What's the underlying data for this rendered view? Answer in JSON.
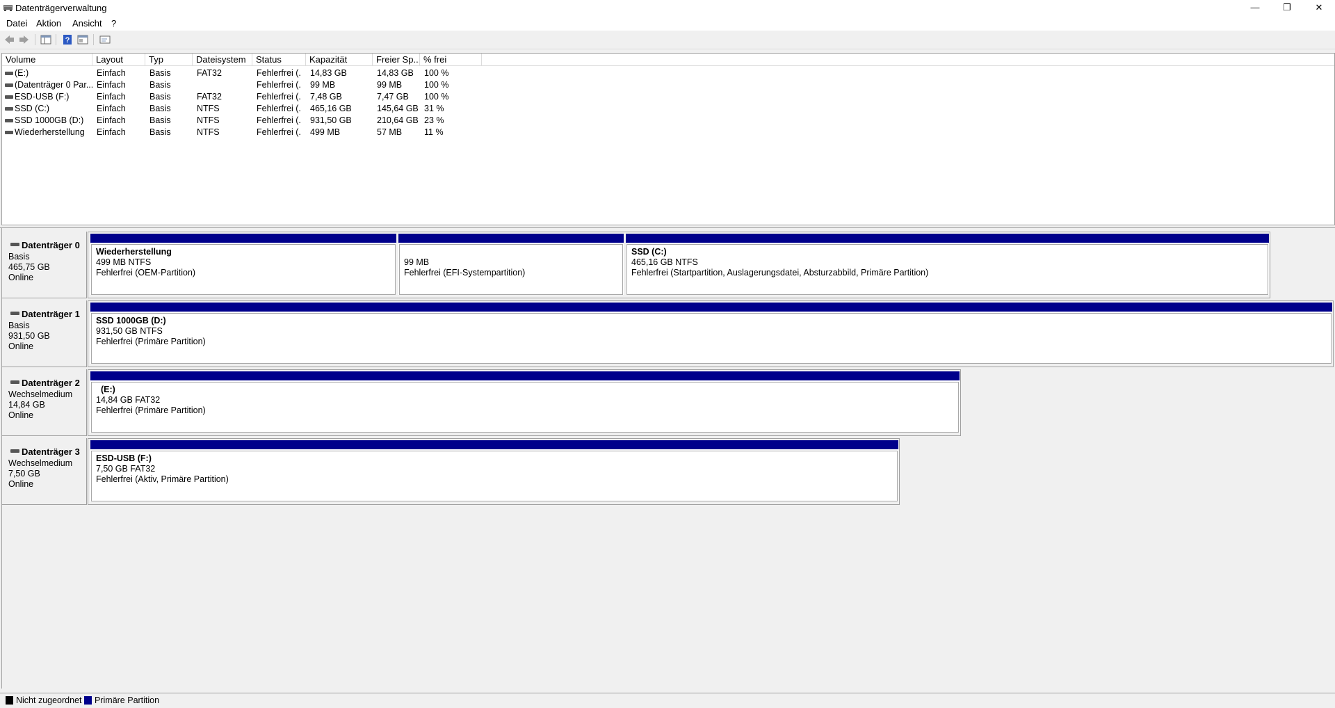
{
  "window": {
    "title": "Datenträgerverwaltung",
    "min": "—",
    "max": "❐",
    "close": "✕"
  },
  "menu": [
    "Datei",
    "Aktion",
    "Ansicht",
    "?"
  ],
  "toolbar": [
    "back-icon",
    "forward-icon",
    "disk-list-icon",
    "help-icon",
    "properties-icon",
    "console-icon"
  ],
  "columns": [
    "Volume",
    "Layout",
    "Typ",
    "Dateisystem",
    "Status",
    "Kapazität",
    "Freier Sp...",
    "% frei"
  ],
  "volumes": [
    [
      "(E:)",
      "Einfach",
      "Basis",
      "FAT32",
      "Fehlerfrei (...",
      "14,83 GB",
      "14,83 GB",
      "100 %"
    ],
    [
      "(Datenträger 0 Par...",
      "Einfach",
      "Basis",
      "",
      "Fehlerfrei (...",
      "99 MB",
      "99 MB",
      "100 %"
    ],
    [
      "ESD-USB (F:)",
      "Einfach",
      "Basis",
      "FAT32",
      "Fehlerfrei (...",
      "7,48 GB",
      "7,47 GB",
      "100 %"
    ],
    [
      "SSD (C:)",
      "Einfach",
      "Basis",
      "NTFS",
      "Fehlerfrei (...",
      "465,16 GB",
      "145,64 GB",
      "31 %"
    ],
    [
      "SSD 1000GB (D:)",
      "Einfach",
      "Basis",
      "NTFS",
      "Fehlerfrei (...",
      "931,50 GB",
      "210,64 GB",
      "23 %"
    ],
    [
      "Wiederherstellung",
      "Einfach",
      "Basis",
      "NTFS",
      "Fehlerfrei (...",
      "499 MB",
      "57 MB",
      "11 %"
    ]
  ],
  "disks": [
    {
      "name": "Datenträger 0",
      "type": "Basis",
      "size": "465,75 GB",
      "status": "Online",
      "partitions": [
        {
          "title": "Wiederherstellung",
          "size": "499 MB NTFS",
          "status": "Fehlerfrei (OEM-Partition)"
        },
        {
          "title": "",
          "size": "99 MB",
          "status": "Fehlerfrei (EFI-Systempartition)"
        },
        {
          "title": "SSD  (C:)",
          "size": "465,16 GB NTFS",
          "status": "Fehlerfrei (Startpartition, Auslagerungsdatei, Absturzabbild, Primäre Partition)"
        }
      ]
    },
    {
      "name": "Datenträger 1",
      "type": "Basis",
      "size": "931,50 GB",
      "status": "Online",
      "partitions": [
        {
          "title": "SSD 1000GB  (D:)",
          "size": "931,50 GB NTFS",
          "status": "Fehlerfrei (Primäre Partition)"
        }
      ]
    },
    {
      "name": "Datenträger 2",
      "type": "Wechselmedium",
      "size": "14,84 GB",
      "status": "Online",
      "partitions": [
        {
          "title": "  (E:)",
          "size": "14,84 GB FAT32",
          "status": "Fehlerfrei (Primäre Partition)"
        }
      ]
    },
    {
      "name": "Datenträger 3",
      "type": "Wechselmedium",
      "size": "7,50 GB",
      "status": "Online",
      "partitions": [
        {
          "title": "ESD-USB  (F:)",
          "size": "7,50 GB FAT32",
          "status": "Fehlerfrei (Aktiv, Primäre Partition)"
        }
      ]
    }
  ],
  "legend": [
    {
      "label": "Nicht zugeordnet",
      "color": "#000000"
    },
    {
      "label": "Primäre Partition",
      "color": "#00008b"
    }
  ]
}
